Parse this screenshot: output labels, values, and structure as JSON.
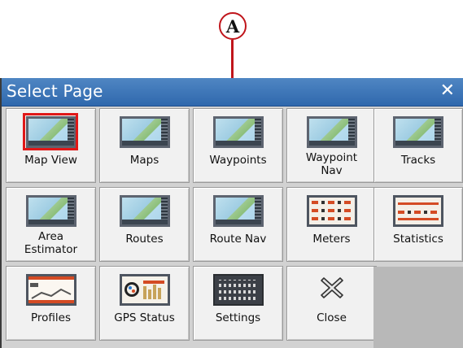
{
  "callout": {
    "letter": "A",
    "color": "#c0151b"
  },
  "dialog": {
    "title": "Select Page",
    "close_glyph": "✕",
    "title_bar_color": "#3a74b6"
  },
  "tiles": [
    {
      "label": "Map View",
      "icon": "map-thumbnail-icon",
      "selected": true
    },
    {
      "label": "Maps",
      "icon": "map-thumbnail-icon"
    },
    {
      "label": "Waypoints",
      "icon": "map-thumbnail-icon"
    },
    {
      "label": "Waypoint\nNav",
      "icon": "map-thumbnail-icon"
    },
    {
      "label": "Tracks",
      "icon": "map-thumbnail-icon"
    },
    {
      "label": "Area\nEstimator",
      "icon": "map-thumbnail-icon"
    },
    {
      "label": "Routes",
      "icon": "map-thumbnail-icon"
    },
    {
      "label": "Route Nav",
      "icon": "map-thumbnail-icon"
    },
    {
      "label": "Meters",
      "icon": "meters-thumbnail-icon"
    },
    {
      "label": "Statistics",
      "icon": "statistics-thumbnail-icon"
    },
    {
      "label": "Profiles",
      "icon": "profile-thumbnail-icon"
    },
    {
      "label": "GPS Status",
      "icon": "gps-status-thumbnail-icon"
    },
    {
      "label": "Settings",
      "icon": "settings-keypad-icon"
    },
    {
      "label": "Close",
      "icon": "close-x-icon"
    }
  ],
  "colors": {
    "selected_outline": "#e01818",
    "dialog_bg": "#d2d2d2"
  }
}
